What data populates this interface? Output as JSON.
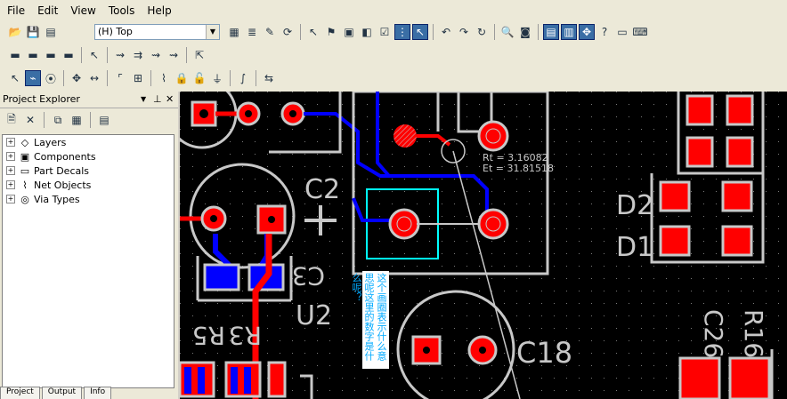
{
  "menu": [
    "File",
    "Edit",
    "View",
    "Tools",
    "Help"
  ],
  "toolbar": {
    "layer_select": "(H) Top"
  },
  "explorer": {
    "title": "Project Explorer",
    "tree": [
      {
        "label": "Layers",
        "icon": "layers-icon"
      },
      {
        "label": "Components",
        "icon": "component-icon"
      },
      {
        "label": "Part Decals",
        "icon": "decal-icon"
      },
      {
        "label": "Net Objects",
        "icon": "net-icon"
      },
      {
        "label": "Via Types",
        "icon": "via-icon"
      }
    ],
    "tabs": [
      "Project",
      "Output",
      "Info"
    ]
  },
  "readout": {
    "rt": "Rt = 3.16082",
    "et": "Et = 31.81518"
  },
  "labels": {
    "c2": "C2",
    "c3": "C3",
    "u2": "U2",
    "r5": "R5",
    "r3": "R3",
    "c18": "C18",
    "d2": "D2",
    "d1": "D1",
    "c26": "C26",
    "r16": "R16"
  },
  "annotation": "这个画圈表示什么意思呢这里的数字是什么呢？",
  "colors": {
    "board": "#000000",
    "pad": "#ff0000",
    "trace": "#0000ff",
    "outline": "#c8c8c8",
    "selection": "#00ffff"
  }
}
